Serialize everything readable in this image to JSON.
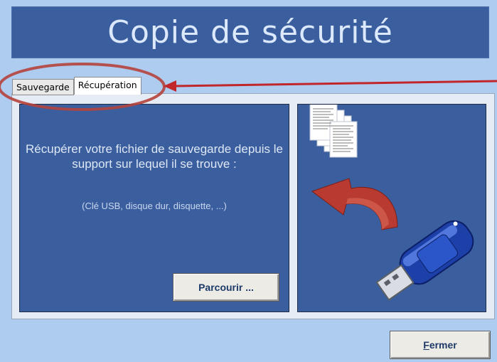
{
  "window": {
    "title": "Copie de sécurité"
  },
  "tabs": [
    {
      "label": "Sauvegarde",
      "active": false
    },
    {
      "label": "Récupération",
      "active": true
    }
  ],
  "restore": {
    "description": "Récupérer votre fichier de sauvegarde depuis le support sur lequel il se trouve :",
    "media_hint": "(Clé USB, disque dur, disquette, ...)",
    "browse_label": "Parcourir ...",
    "illustration_icons": [
      "documents-icon",
      "curved-arrow-icon",
      "usb-key-icon"
    ]
  },
  "footer": {
    "close_label_accel": "F",
    "close_label_rest": "ermer"
  },
  "colors": {
    "background": "#aecbf0",
    "panel_blue": "#3b5f9e",
    "annotation_red": "#c0262a"
  }
}
